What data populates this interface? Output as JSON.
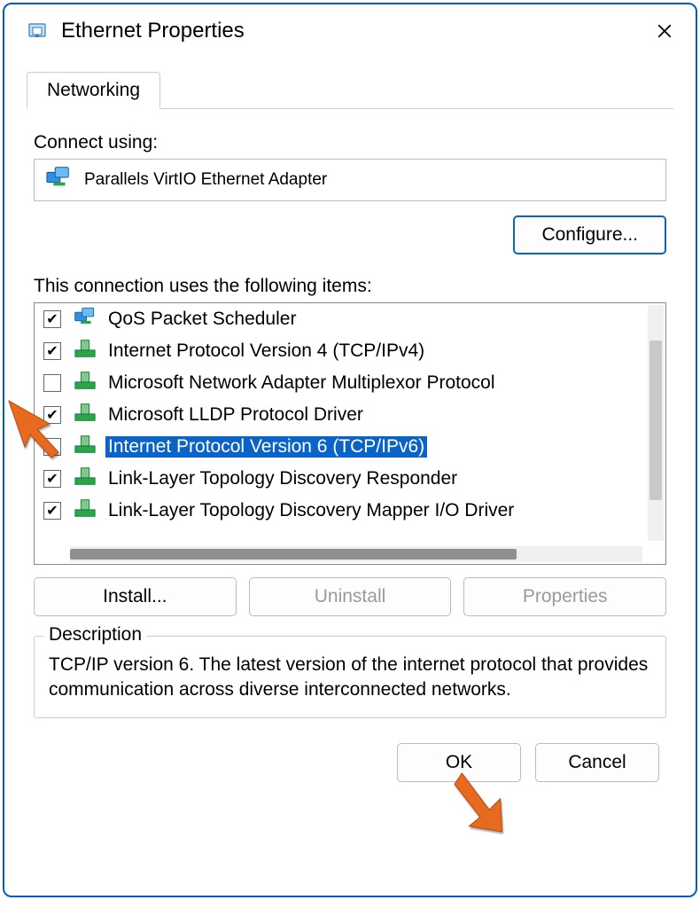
{
  "window": {
    "title": "Ethernet Properties"
  },
  "tab": {
    "networking": "Networking"
  },
  "connect_using_label": "Connect using:",
  "adapter_name": "Parallels VirtIO Ethernet Adapter",
  "configure_btn": "Configure...",
  "items_label": "This connection uses the following items:",
  "items": [
    {
      "checked": true,
      "label": "QoS Packet Scheduler",
      "icon": "nic",
      "selected": false
    },
    {
      "checked": true,
      "label": "Internet Protocol Version 4 (TCP/IPv4)",
      "icon": "proto",
      "selected": false
    },
    {
      "checked": false,
      "label": "Microsoft Network Adapter Multiplexor Protocol",
      "icon": "proto",
      "selected": false
    },
    {
      "checked": true,
      "label": "Microsoft LLDP Protocol Driver",
      "icon": "proto",
      "selected": false
    },
    {
      "checked": false,
      "label": "Internet Protocol Version 6 (TCP/IPv6)",
      "icon": "proto",
      "selected": true
    },
    {
      "checked": true,
      "label": "Link-Layer Topology Discovery Responder",
      "icon": "proto",
      "selected": false
    },
    {
      "checked": true,
      "label": "Link-Layer Topology Discovery Mapper I/O Driver",
      "icon": "proto",
      "selected": false
    }
  ],
  "buttons": {
    "install": "Install...",
    "uninstall": "Uninstall",
    "properties": "Properties",
    "ok": "OK",
    "cancel": "Cancel"
  },
  "group_title": "Description",
  "description": "TCP/IP version 6. The latest version of the internet protocol that provides communication across diverse interconnected networks."
}
